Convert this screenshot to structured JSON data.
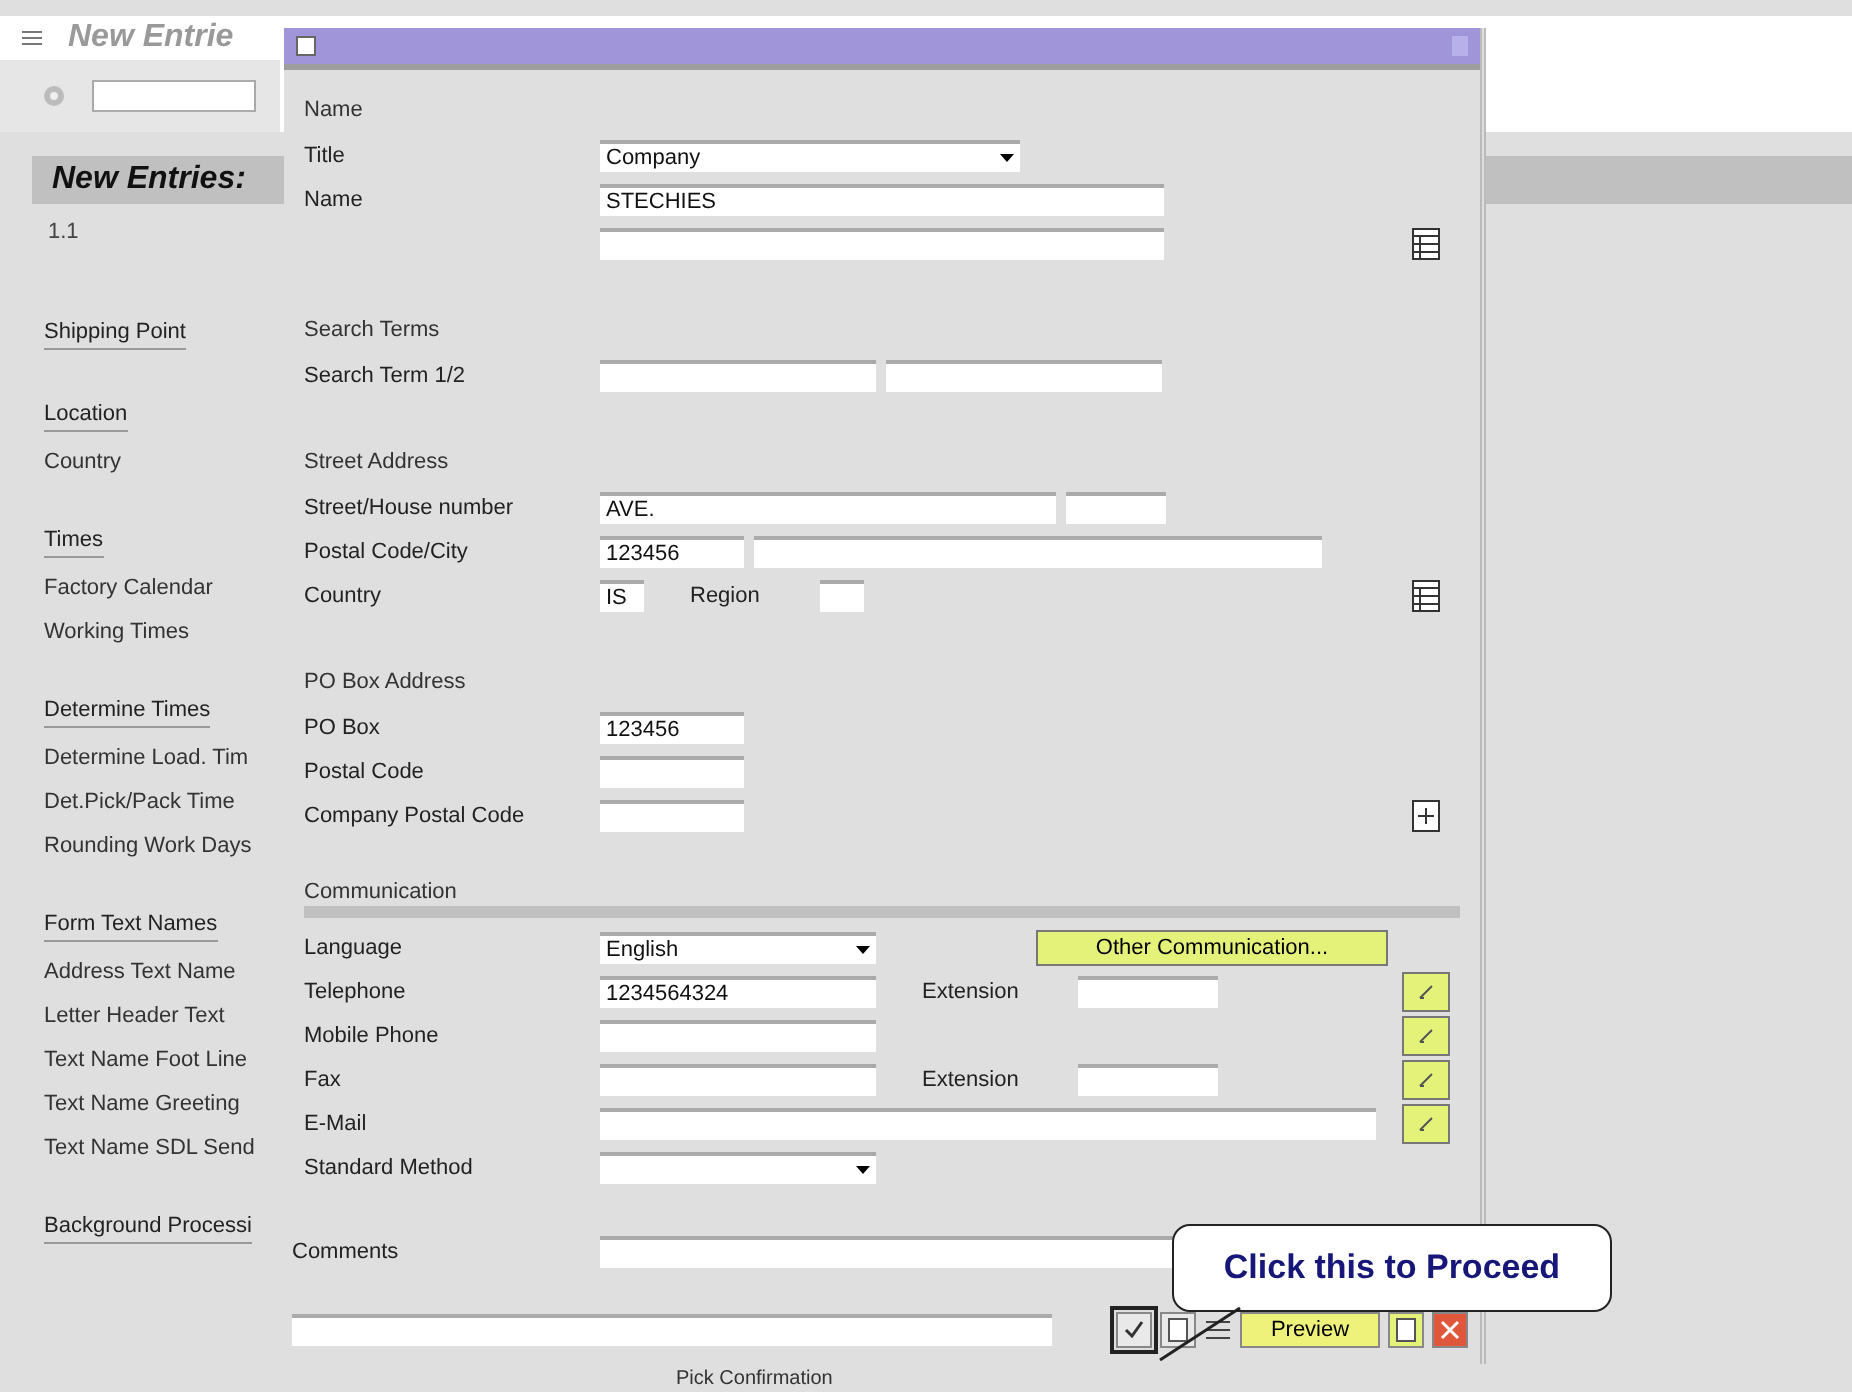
{
  "background": {
    "header": "New Entrie",
    "page_title": "New Entries:",
    "item_code": "1.1",
    "menu": [
      {
        "kind": "heading",
        "text": "Shipping Point"
      },
      {
        "kind": "heading",
        "text": "Location"
      },
      {
        "kind": "item",
        "text": "Country"
      },
      {
        "kind": "heading",
        "text": "Times"
      },
      {
        "kind": "item",
        "text": "Factory Calendar"
      },
      {
        "kind": "item",
        "text": "Working Times"
      },
      {
        "kind": "heading",
        "text": "Determine Times"
      },
      {
        "kind": "item",
        "text": "Determine Load. Tim"
      },
      {
        "kind": "item",
        "text": "Det.Pick/Pack Time"
      },
      {
        "kind": "item",
        "text": "Rounding Work Days"
      },
      {
        "kind": "heading",
        "text": "Form Text Names"
      },
      {
        "kind": "item",
        "text": "Address Text Name"
      },
      {
        "kind": "item",
        "text": "Letter Header Text"
      },
      {
        "kind": "item",
        "text": "Text Name Foot Line"
      },
      {
        "kind": "item",
        "text": "Text Name Greeting"
      },
      {
        "kind": "item",
        "text": "Text Name SDL Send"
      },
      {
        "kind": "heading",
        "text": "Background Processi"
      }
    ],
    "footer_text": "Pick Confirmation"
  },
  "dialog": {
    "sections": [
      {
        "title": "Name",
        "rows": [
          {
            "label": "Title",
            "fields": [
              {
                "kind": "dropdown",
                "value": "Company"
              }
            ]
          },
          {
            "label": "Name",
            "fields": [
              {
                "kind": "text",
                "value": "STECHIES"
              }
            ]
          },
          {
            "fields": [
              {
                "kind": "text"
              }
            ],
            "action": {
              "kind": "table"
            }
          }
        ]
      },
      {
        "title": "Search Terms",
        "rows": [
          {
            "label": "Search Term 1/2",
            "fields": [
              {
                "kind": "half"
              },
              {
                "kind": "half"
              }
            ]
          }
        ]
      },
      {
        "title": "Street Address",
        "rows": [
          {
            "label": "Street/House number",
            "fields": [
              {
                "kind": "street",
                "value": "AVE."
              },
              {
                "kind": "house"
              }
            ]
          },
          {
            "label": "Postal Code/City",
            "fields": [
              {
                "kind": "short",
                "value": "123456"
              },
              {
                "kind": "city"
              }
            ]
          },
          {
            "label": "Country",
            "fields": [
              {
                "kind": "tiny",
                "value": "IS"
              },
              {
                "kind": "label",
                "value": "Region"
              },
              {
                "kind": "tiny"
              }
            ],
            "action": {
              "kind": "table"
            }
          }
        ]
      },
      {
        "title": "PO Box Address",
        "rows": [
          {
            "label": "PO Box",
            "fields": [
              {
                "kind": "short",
                "value": "123456"
              }
            ]
          },
          {
            "label": "Postal Code",
            "fields": [
              {
                "kind": "short"
              }
            ]
          },
          {
            "label": "Company Postal Code",
            "fields": [
              {
                "kind": "short"
              }
            ],
            "action": {
              "kind": "table-add"
            }
          }
        ]
      },
      {
        "title": "Communication",
        "rows": [
          {
            "label": "Language",
            "fields": [
              {
                "kind": "dropdown-half",
                "value": "English"
              },
              {
                "kind": "button",
                "value": "Other Communication..."
              }
            ]
          },
          {
            "label": "Telephone",
            "fields": [
              {
                "kind": "half",
                "value": "1234564324"
              },
              {
                "kind": "label",
                "value": "Extension"
              },
              {
                "kind": "ext"
              }
            ],
            "action": {
              "kind": "more"
            }
          },
          {
            "label": "Mobile Phone",
            "fields": [
              {
                "kind": "half"
              }
            ],
            "action": {
              "kind": "more"
            }
          },
          {
            "label": "Fax",
            "fields": [
              {
                "kind": "half"
              },
              {
                "kind": "label",
                "value": "Extension"
              },
              {
                "kind": "ext"
              }
            ],
            "action": {
              "kind": "more"
            }
          },
          {
            "label": "E-Mail",
            "fields": [
              {
                "kind": "email"
              }
            ],
            "action": {
              "kind": "more"
            }
          },
          {
            "label": "Standard Method",
            "fields": [
              {
                "kind": "dropdown-half"
              }
            ]
          }
        ]
      }
    ],
    "comments_label": "Comments",
    "toolbar": {
      "preview": "Preview"
    }
  },
  "callout": {
    "text": "Click this to Proceed"
  }
}
